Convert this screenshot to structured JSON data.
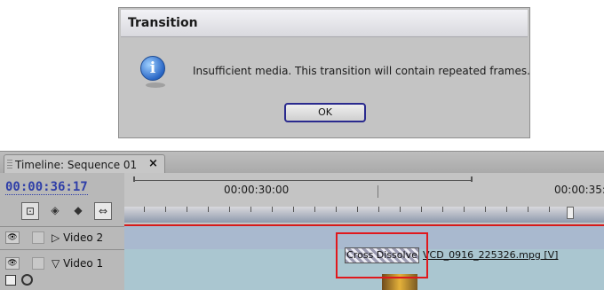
{
  "dialog": {
    "title": "Transition",
    "message": "Insufficient media. This transition will contain repeated frames.",
    "ok_label": "OK",
    "icon": "info-icon"
  },
  "timeline": {
    "tab_label": "Timeline: Sequence 01",
    "tab_close": "×",
    "timecode": "00:00:36:17",
    "ruler_times": [
      "00:00:30:00",
      "00:00:35:"
    ],
    "tracks": [
      {
        "name": "Video 2",
        "expand": "▷"
      },
      {
        "name": "Video 1",
        "expand": "▽"
      }
    ],
    "transition_label": "Cross Dissolve",
    "clip_name": "VCD_0916_225326.mpg [V]",
    "colors": {
      "timecode": "#2f3fa8",
      "track_area": "#9aaec9",
      "marker_line": "#d61a1a",
      "highlight_box": "#e0181d"
    }
  }
}
